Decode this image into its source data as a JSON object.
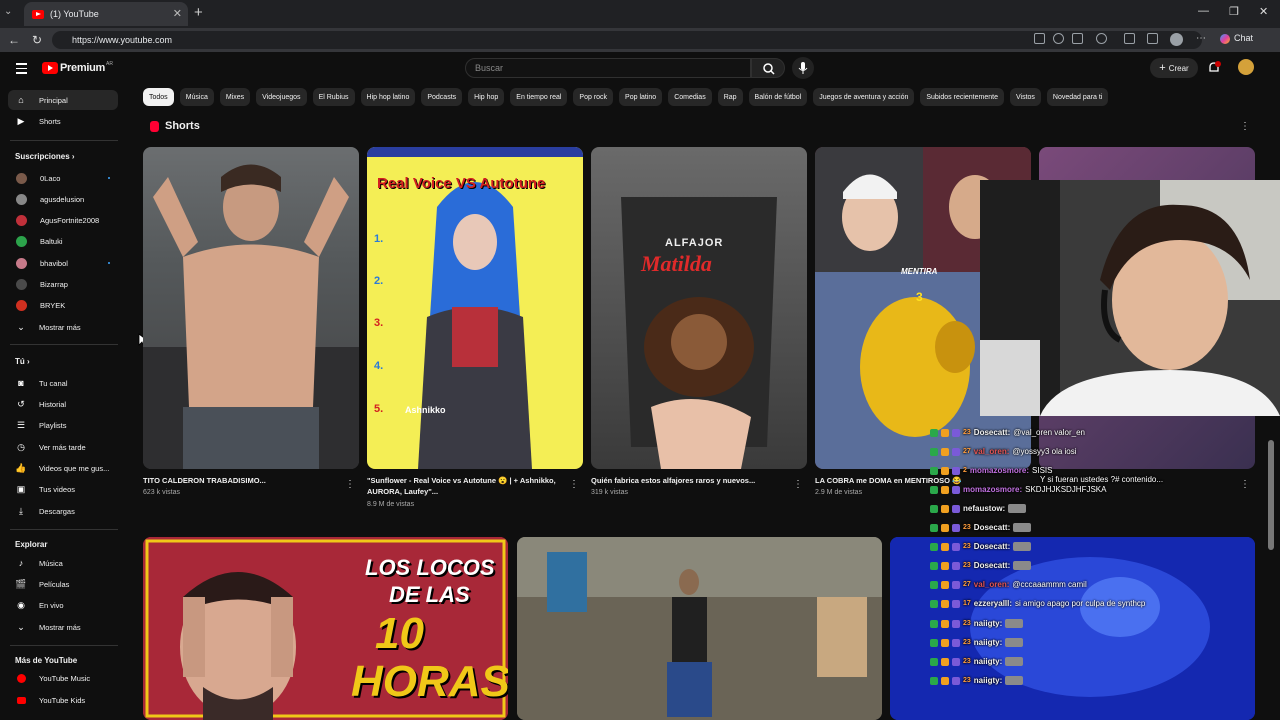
{
  "browser": {
    "tab_title": "(1) YouTube",
    "url": "https://www.youtube.com",
    "chat_label": "Chat"
  },
  "header": {
    "logo_text": "Premium",
    "logo_sup": "AR",
    "search_placeholder": "Buscar",
    "create_label": "Crear",
    "notification_count": "1"
  },
  "sidebar": {
    "main": [
      {
        "label": "Principal",
        "icon": "home-icon"
      },
      {
        "label": "Shorts",
        "icon": "shorts-icon"
      }
    ],
    "subs_title": "Suscripciones",
    "subs": [
      {
        "label": "0Laco",
        "color": "#7a5a4a",
        "dot": true
      },
      {
        "label": "agusdelusion",
        "color": "#888888",
        "dot": false
      },
      {
        "label": "AgusFortnite2008",
        "color": "#c0303a",
        "dot": false
      },
      {
        "label": "Baltuki",
        "color": "#2ca34b",
        "dot": false
      },
      {
        "label": "bhavibol",
        "color": "#c77a8a",
        "dot": true
      },
      {
        "label": "Bizarrap",
        "color": "#4a4a4a",
        "dot": false
      },
      {
        "label": "BRYEK",
        "color": "#d03020",
        "dot": false
      }
    ],
    "subs_more": "Mostrar más",
    "you_title": "Tú",
    "you": [
      {
        "label": "Tu canal",
        "icon": "channel-icon"
      },
      {
        "label": "Historial",
        "icon": "history-icon"
      },
      {
        "label": "Playlists",
        "icon": "playlists-icon"
      },
      {
        "label": "Ver más tarde",
        "icon": "watch-later-icon"
      },
      {
        "label": "Videos que me gus...",
        "icon": "like-icon"
      },
      {
        "label": "Tus videos",
        "icon": "your-videos-icon"
      },
      {
        "label": "Descargas",
        "icon": "download-icon"
      }
    ],
    "explore_title": "Explorar",
    "explore": [
      {
        "label": "Música",
        "icon": "music-icon"
      },
      {
        "label": "Películas",
        "icon": "movies-icon"
      },
      {
        "label": "En vivo",
        "icon": "live-icon"
      },
      {
        "label": "Mostrar más",
        "icon": "chevron-down-icon"
      }
    ],
    "more_title": "Más de YouTube",
    "more": [
      {
        "label": "YouTube Music",
        "icon": "yt-music-icon"
      },
      {
        "label": "YouTube Kids",
        "icon": "yt-kids-icon"
      }
    ]
  },
  "chips": [
    "Todos",
    "Música",
    "Mixes",
    "Videojuegos",
    "El Rubius",
    "Hip hop latino",
    "Podcasts",
    "Hip hop",
    "En tiempo real",
    "Pop rock",
    "Pop latino",
    "Comedias",
    "Rap",
    "Balón de fútbol",
    "Juegos de aventura y acción",
    "Subidos recientemente",
    "Vistos",
    "Novedad para ti"
  ],
  "shorts_title": "Shorts",
  "shorts": [
    {
      "title": "TITO CALDERON TRABADISIMO...",
      "views": "623 k vistas"
    },
    {
      "title": "\"Sunflower - Real Voice vs Autotune 😮 | + Ashnikko, AURORA, Laufey\"...",
      "views": "8.9 M de vistas",
      "overlay_title": "Real Voice VS Autotune",
      "overlay_name": "Ashnikko",
      "numbers": [
        "1.",
        "2.",
        "3.",
        "4.",
        "5."
      ]
    },
    {
      "title": "Quién fabrica estos alfajores raros y nuevos...",
      "views": "319 k vistas",
      "brand": "ALFAJOR",
      "brand2": "Matilda"
    },
    {
      "title": "LA COBRA me DOMA en MENTIROSO 😂",
      "views": "2.9 M de vistas",
      "overlay_word": "MENTIRA",
      "overlay_num": "3"
    }
  ],
  "video_thumb_text": [
    "LOS LOCOS",
    "DE LAS",
    "10",
    "HORAS"
  ],
  "chat": [
    {
      "user": "Dosecatt:",
      "bits": "23",
      "msg": "@val_oren valor_en",
      "color": "#f1f1f1"
    },
    {
      "user": "val_oren:",
      "bits": "27",
      "msg": "@yossyy3 ola iosi",
      "color": "#e35353"
    },
    {
      "user": "momazosmore:",
      "bits": "2",
      "msg": "SISIS",
      "color": "#c070e0"
    },
    {
      "user": "",
      "bits": "",
      "msg": "Y si fueran ustedes ?# contenido...",
      "color": "#f1f1f1"
    },
    {
      "user": "momazosmore:",
      "bits": "",
      "msg": "SKDJHJKSDJHFJSKA",
      "color": "#c070e0"
    },
    {
      "user": "nefaustow:",
      "bits": "",
      "msg": "",
      "color": "#f1f1f1"
    },
    {
      "user": "Dosecatt:",
      "bits": "23",
      "msg": "",
      "color": "#f1f1f1"
    },
    {
      "user": "Dosecatt:",
      "bits": "23",
      "msg": "",
      "color": "#f1f1f1"
    },
    {
      "user": "Dosecatt:",
      "bits": "23",
      "msg": "",
      "color": "#f1f1f1"
    },
    {
      "user": "val_oren:",
      "bits": "27",
      "msg": "@cccaaammm camil",
      "color": "#e35353"
    },
    {
      "user": "ezzeryalll:",
      "bits": "17",
      "msg": "si amigo apago por culpa de synthcp",
      "color": "#f1f1f1"
    },
    {
      "user": "naiigty:",
      "bits": "23",
      "msg": "",
      "color": "#f1f1f1"
    },
    {
      "user": "naiigty:",
      "bits": "23",
      "msg": "",
      "color": "#f1f1f1"
    },
    {
      "user": "naiigty:",
      "bits": "23",
      "msg": "",
      "color": "#f1f1f1"
    },
    {
      "user": "naiigty:",
      "bits": "23",
      "msg": "",
      "color": "#f1f1f1"
    }
  ],
  "colors": {
    "yt_red": "#ff0000",
    "bg": "#0f0f0f",
    "chip": "#272727"
  }
}
